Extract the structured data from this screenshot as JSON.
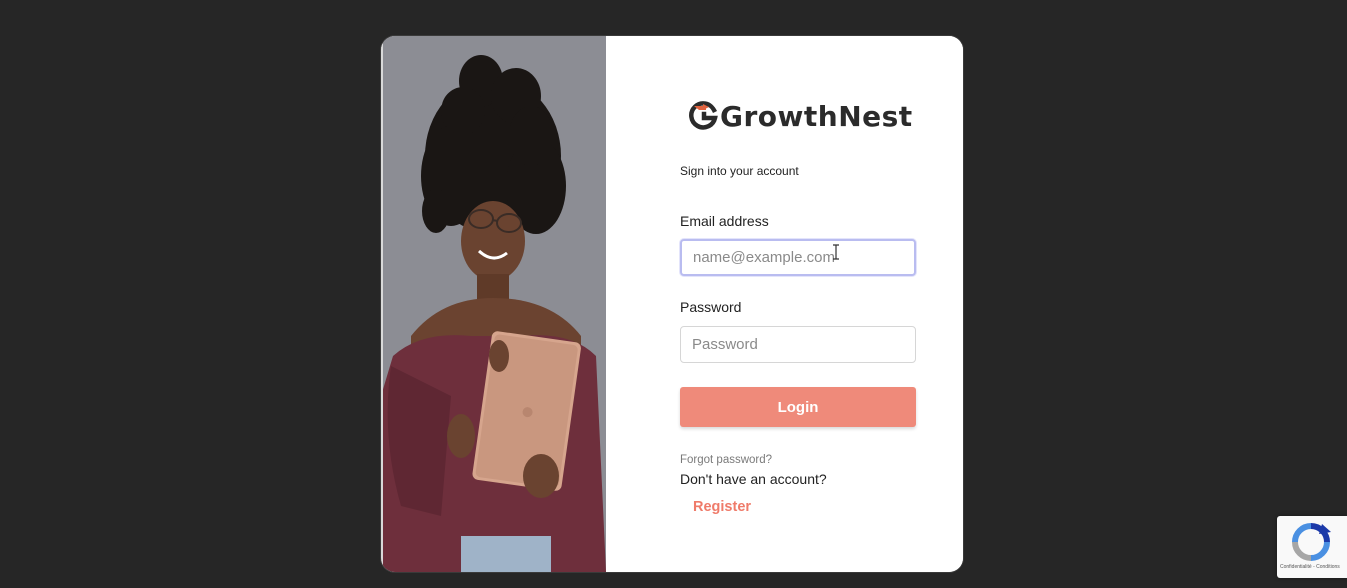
{
  "brand": {
    "name": "GrowthNest",
    "accent_color": "#ef8a7a",
    "logo_mark_color": "#e0633f"
  },
  "form": {
    "subtitle": "Sign into your account",
    "email_label": "Email address",
    "email_placeholder": "name@example.com",
    "password_label": "Password",
    "password_placeholder": "Password",
    "login_label": "Login",
    "forgot_label": "Forgot password?",
    "no_account_text": "Don't have an account?",
    "register_label": "Register"
  },
  "recaptcha": {
    "icon": "recaptcha-icon",
    "footer": "Confidentialité - Conditions"
  }
}
